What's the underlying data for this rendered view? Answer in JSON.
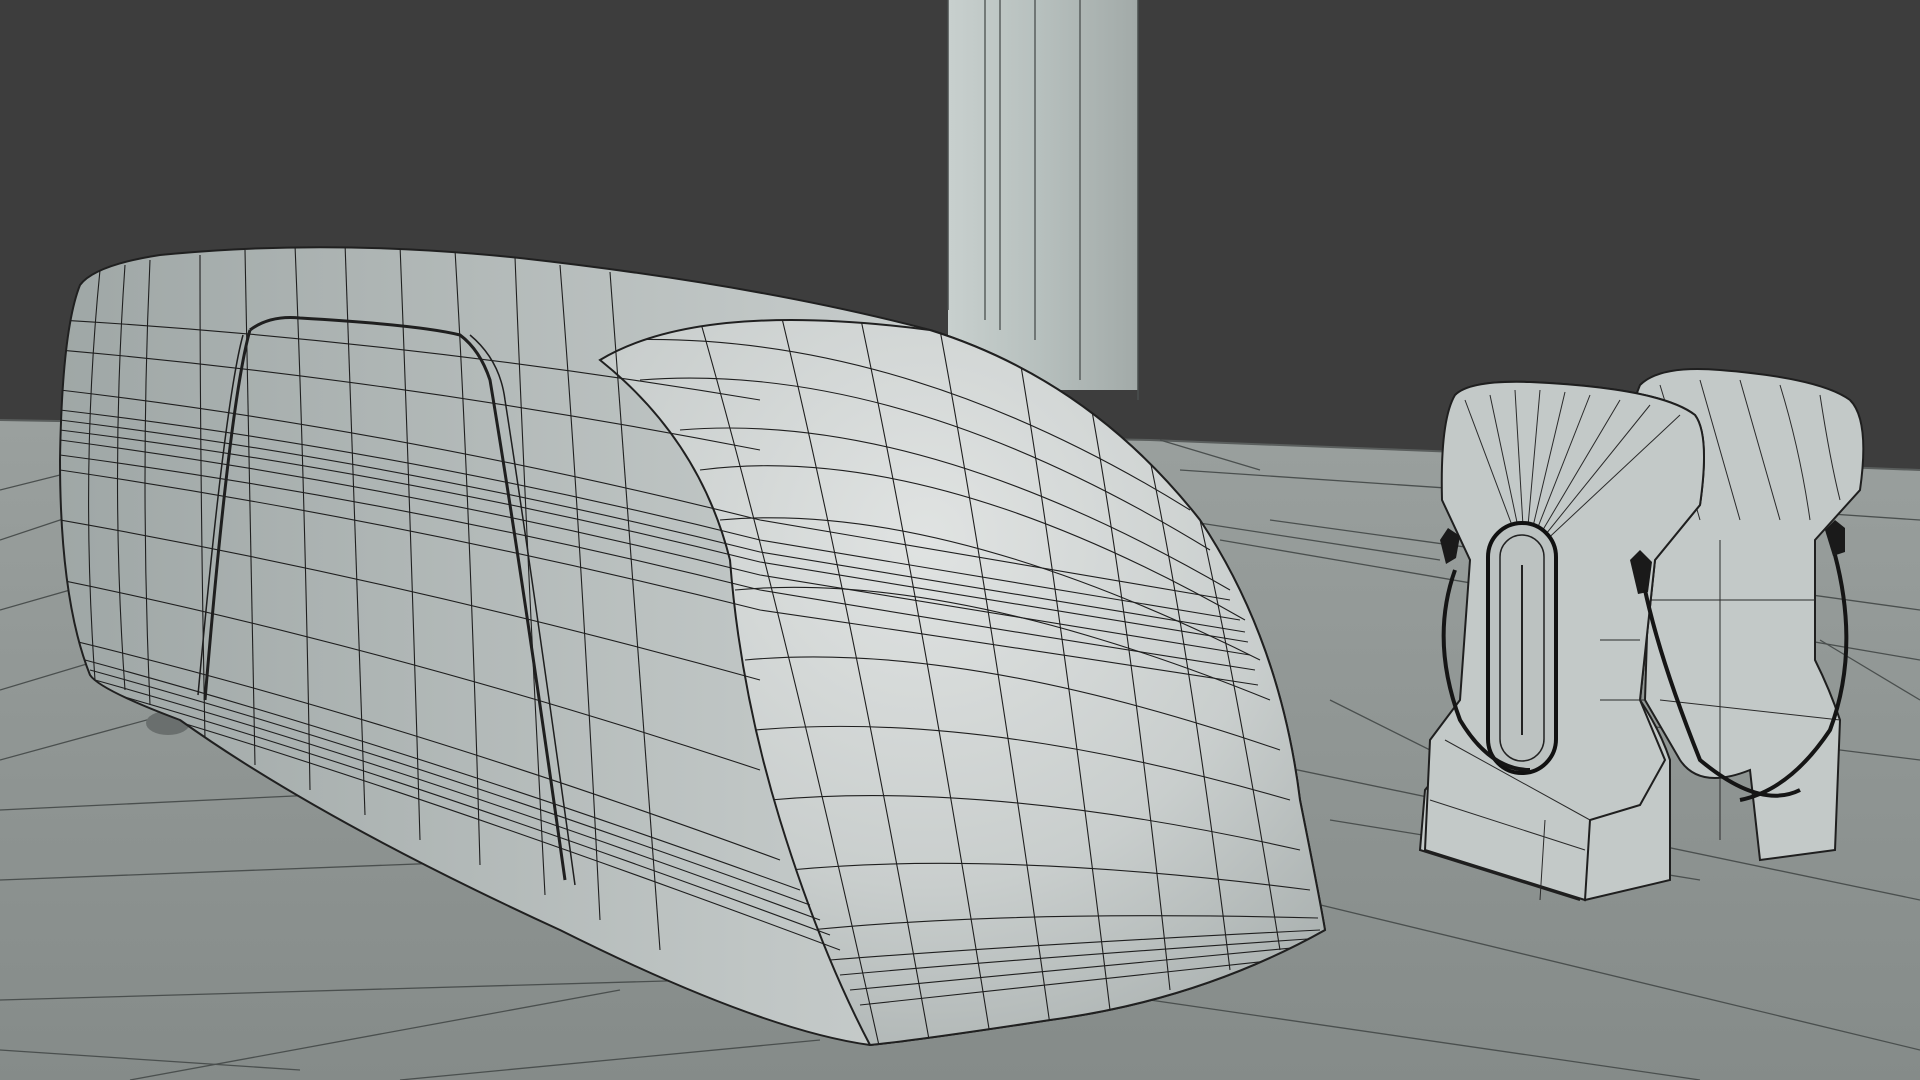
{
  "viewport": {
    "kind": "3d-wireframe-render",
    "background_color": "#3d3d3d",
    "floor_color": "#8f9593",
    "wall_color": "#3d3d3d",
    "pillar_color": "#b8c2c0",
    "vehicle_color": "#c4cac9",
    "charger_color": "#c3c9c8",
    "wire_color": "#222222",
    "cable_color": "#151515"
  },
  "objects": [
    {
      "name": "floor",
      "label": ""
    },
    {
      "name": "back-wall",
      "label": ""
    },
    {
      "name": "support-pillar",
      "label": ""
    },
    {
      "name": "autonomous-pod-vehicle",
      "label": ""
    },
    {
      "name": "ev-charging-station-left",
      "label": ""
    },
    {
      "name": "ev-charging-station-right",
      "label": ""
    }
  ]
}
